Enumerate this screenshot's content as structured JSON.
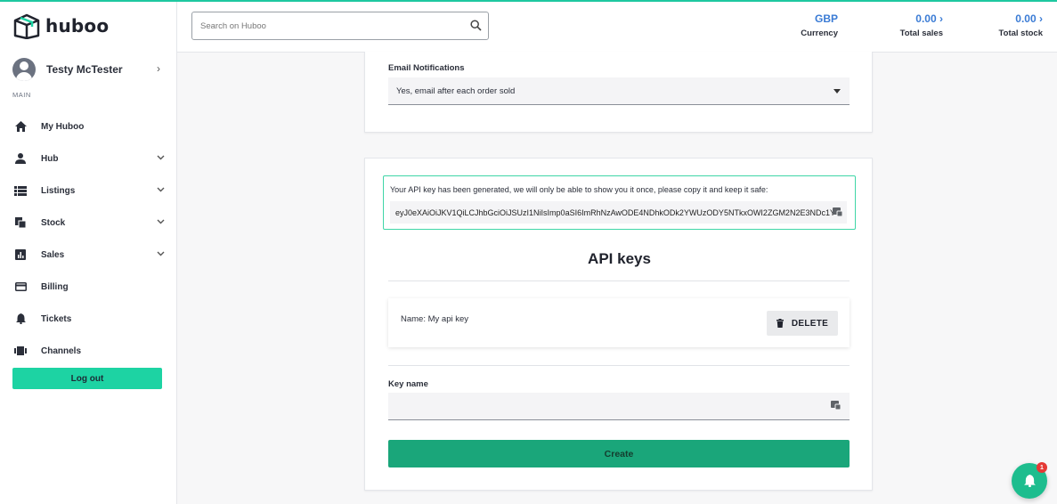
{
  "app": {
    "logo_text": "huboo"
  },
  "sidebar": {
    "user_name": "Testy McTester",
    "section_label": "MAIN",
    "items": [
      {
        "label": "My Huboo",
        "icon": "home-icon",
        "has_chevron": false
      },
      {
        "label": "Hub",
        "icon": "person-icon",
        "has_chevron": true
      },
      {
        "label": "Listings",
        "icon": "list-icon",
        "has_chevron": true
      },
      {
        "label": "Stock",
        "icon": "stock-icon",
        "has_chevron": true
      },
      {
        "label": "Sales",
        "icon": "chart-icon",
        "has_chevron": true
      },
      {
        "label": "Billing",
        "icon": "card-icon",
        "has_chevron": false
      },
      {
        "label": "Tickets",
        "icon": "bell-icon",
        "has_chevron": false
      },
      {
        "label": "Channels",
        "icon": "channels-icon",
        "has_chevron": false
      }
    ],
    "logout_label": "Log out"
  },
  "header": {
    "search_placeholder": "Search on Huboo",
    "currency": {
      "value": "GBP",
      "label": "Currency"
    },
    "total_sales": {
      "value": "0.00",
      "label": "Total sales"
    },
    "total_stock": {
      "value": "0.00",
      "label": "Total stock"
    }
  },
  "notifications_card": {
    "label": "Email Notifications",
    "selected": "Yes, email after each order sold"
  },
  "api_card": {
    "generated_message": "Your API key has been generated, we will only be able to show you it once, please copy it and keep it safe:",
    "generated_key": "eyJ0eXAiOiJKV1QiLCJhbGciOiJSUzI1NiIsImp0aSI6ImRhNzAwODE4NDhkODk2YWUzODY5NTkxOWI2ZGM2N2E3NDc1Y",
    "title": "API keys",
    "keys": [
      {
        "name": "Name: My api key",
        "delete_label": "DELETE"
      }
    ],
    "key_name_label": "Key name",
    "key_name_value": "",
    "create_label": "Create"
  },
  "notifications_badge": "1",
  "colors": {
    "accent": "#1dd3a3",
    "link": "#3a7bd5",
    "create": "#1aa67a"
  }
}
